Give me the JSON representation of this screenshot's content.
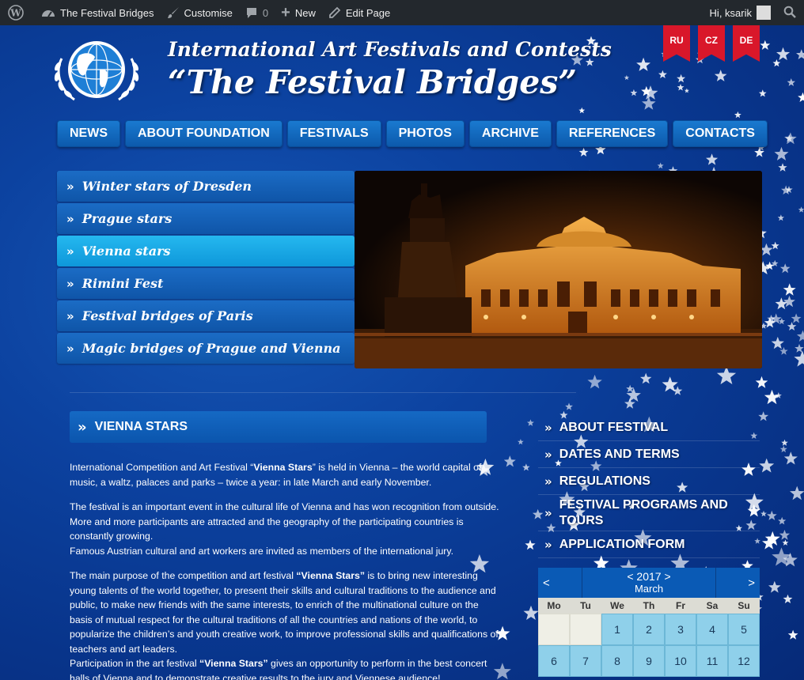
{
  "adminbar": {
    "site_name": "The Festival Bridges",
    "customise": "Customise",
    "comments_count": "0",
    "new_label": "New",
    "edit_page": "Edit Page",
    "greeting": "Hi, ksarik"
  },
  "header": {
    "line1": "International Art Festivals and Contests",
    "line2": "“The Festival Bridges”"
  },
  "languages": [
    "RU",
    "CZ",
    "DE"
  ],
  "nav": [
    "NEWS",
    "ABOUT FOUNDATION",
    "FESTIVALS",
    "PHOTOS",
    "ARCHIVE",
    "REFERENCES",
    "CONTACTS"
  ],
  "festivals": [
    {
      "label": "Winter stars of Dresden",
      "active": false
    },
    {
      "label": "Prague stars",
      "active": false
    },
    {
      "label": "Vienna stars",
      "active": true
    },
    {
      "label": "Rimini Fest",
      "active": false
    },
    {
      "label": "Festival bridges of Paris",
      "active": false
    },
    {
      "label": "Magic bridges of Prague and Vienna",
      "active": false
    }
  ],
  "page": {
    "heading": "VIENNA STARS",
    "p1_a": "International Competition and Art Festival “",
    "p1_b": "Vienna Stars",
    "p1_c": "” is held in Vienna – the world capital of music, a waltz, palaces and parks – twice a year: in late March and early November.",
    "p2": "The festival is an important event in the cultural life of Vienna and has won recognition from outside. More and more participants are attracted and the geography of the participating countries is constantly growing.",
    "p3": "Famous Austrian cultural and art workers are invited as members of the international jury.",
    "p4_a": "The main purpose of the competition and art festival ",
    "p4_b": "“Vienna Stars”",
    "p4_c": " is to bring new interesting young talents of the world together, to present their skills and cultural traditions to the audience and public, to make new friends with the same interests, to enrich of the multinational culture on the basis of mutual respect for the cultural traditions of all the countries and nations of the world, to popularize the children’s and youth creative work, to improve professional skills and qualifications of teachers and art leaders.",
    "p5_a": "Participation in the art festival ",
    "p5_b": "“Vienna Stars”",
    "p5_c": " gives an opportunity to perform in the best concert halls of Vienna and to demonstrate creative results to the jury and Viennese audience!"
  },
  "side_menu": [
    "ABOUT FESTIVAL",
    "DATES AND TERMS",
    "REGULATIONS",
    "FESTIVAL PROGRAMS AND TOURS",
    "APPLICATION FORM"
  ],
  "calendar": {
    "prev": "<",
    "next": ">",
    "year_line": "< 2017 >",
    "month": "March",
    "weekdays": [
      "Mo",
      "Tu",
      "We",
      "Th",
      "Fr",
      "Sa",
      "Su"
    ],
    "cells": [
      "",
      "",
      "1",
      "2",
      "3",
      "4",
      "5",
      "6",
      "7",
      "8",
      "9",
      "10",
      "11",
      "12"
    ]
  },
  "colors": {
    "page_bg": "#0b3d8c",
    "nav_button": "#1468c2",
    "active_item": "#1aa8e6",
    "flag_red": "#d9172a",
    "calendar_cell": "#8fd0ea"
  }
}
